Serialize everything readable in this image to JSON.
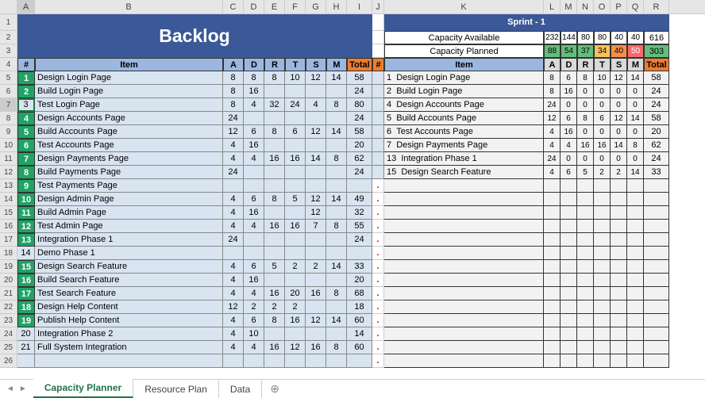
{
  "columns": [
    "",
    "A",
    "B",
    "C",
    "D",
    "E",
    "F",
    "G",
    "H",
    "I",
    "J",
    "K",
    "L",
    "M",
    "N",
    "O",
    "P",
    "Q",
    "R"
  ],
  "column_widths": [
    "22",
    "22",
    "237",
    "26",
    "26",
    "26",
    "26",
    "26",
    "26",
    "32",
    "15",
    "201",
    "21",
    "21",
    "21",
    "21",
    "21",
    "21",
    "32"
  ],
  "selected_cell": "A7",
  "selected_row": 7,
  "backlog_title": "Backlog",
  "sprint_title": "Sprint - 1",
  "capacity_available_label": "Capacity Available",
  "capacity_planned_label": "Capacity Planned",
  "capacity_available": {
    "A": "232",
    "D": "144",
    "R": "80",
    "T": "80",
    "S": "40",
    "M": "40",
    "Total": "616"
  },
  "capacity_planned": {
    "A": "88",
    "D": "54",
    "R": "37",
    "T": "34",
    "S": "40",
    "M": "50",
    "Total": "303"
  },
  "headers_left": {
    "num": "#",
    "item": "Item",
    "a": "A",
    "d": "D",
    "r": "R",
    "t": "T",
    "s": "S",
    "m": "M",
    "total": "Total"
  },
  "headers_right": {
    "num": "#",
    "item": "Item",
    "a": "A",
    "d": "D",
    "r": "R",
    "t": "T",
    "s": "S",
    "m": "M",
    "total": "Total"
  },
  "backlog": [
    {
      "n": "1",
      "item": "Design Login Page",
      "a": "8",
      "d": "8",
      "r": "8",
      "t": "10",
      "s": "12",
      "m": "14",
      "tot": "58",
      "green": true
    },
    {
      "n": "2",
      "item": "Build Login Page",
      "a": "8",
      "d": "16",
      "r": "",
      "t": "",
      "s": "",
      "m": "",
      "tot": "24",
      "green": true
    },
    {
      "n": "3",
      "item": "Test Login Page",
      "a": "8",
      "d": "4",
      "r": "32",
      "t": "24",
      "s": "4",
      "m": "8",
      "tot": "80",
      "green": false
    },
    {
      "n": "4",
      "item": "Design Accounts Page",
      "a": "24",
      "d": "",
      "r": "",
      "t": "",
      "s": "",
      "m": "",
      "tot": "24",
      "green": true
    },
    {
      "n": "5",
      "item": "Build Accounts Page",
      "a": "12",
      "d": "6",
      "r": "8",
      "t": "6",
      "s": "12",
      "m": "14",
      "tot": "58",
      "green": true
    },
    {
      "n": "6",
      "item": "Test Accounts Page",
      "a": "4",
      "d": "16",
      "r": "",
      "t": "",
      "s": "",
      "m": "",
      "tot": "20",
      "green": true
    },
    {
      "n": "7",
      "item": "Design Payments Page",
      "a": "4",
      "d": "4",
      "r": "16",
      "t": "16",
      "s": "14",
      "m": "8",
      "tot": "62",
      "green": true
    },
    {
      "n": "8",
      "item": "Build Payments Page",
      "a": "24",
      "d": "",
      "r": "",
      "t": "",
      "s": "",
      "m": "",
      "tot": "24",
      "green": true
    },
    {
      "n": "9",
      "item": "Test Payments Page",
      "a": "",
      "d": "",
      "r": "",
      "t": "",
      "s": "",
      "m": "",
      "tot": "",
      "green": true
    },
    {
      "n": "10",
      "item": "Design Admin Page",
      "a": "4",
      "d": "6",
      "r": "8",
      "t": "5",
      "s": "12",
      "m": "14",
      "tot": "49",
      "green": true
    },
    {
      "n": "11",
      "item": "Build Admin Page",
      "a": "4",
      "d": "16",
      "r": "",
      "t": "",
      "s": "12",
      "m": "",
      "tot": "32",
      "green": true
    },
    {
      "n": "12",
      "item": "Test Admin Page",
      "a": "4",
      "d": "4",
      "r": "16",
      "t": "16",
      "s": "7",
      "m": "8",
      "tot": "55",
      "green": true
    },
    {
      "n": "13",
      "item": "Integration Phase 1",
      "a": "24",
      "d": "",
      "r": "",
      "t": "",
      "s": "",
      "m": "",
      "tot": "24",
      "green": true
    },
    {
      "n": "14",
      "item": "Demo Phase 1",
      "a": "",
      "d": "",
      "r": "",
      "t": "",
      "s": "",
      "m": "",
      "tot": "",
      "green": false
    },
    {
      "n": "15",
      "item": "Design Search Feature",
      "a": "4",
      "d": "6",
      "r": "5",
      "t": "2",
      "s": "2",
      "m": "14",
      "tot": "33",
      "green": true
    },
    {
      "n": "16",
      "item": "Build Search Feature",
      "a": "4",
      "d": "16",
      "r": "",
      "t": "",
      "s": "",
      "m": "",
      "tot": "20",
      "green": true
    },
    {
      "n": "17",
      "item": "Test Search Feature",
      "a": "4",
      "d": "4",
      "r": "16",
      "t": "20",
      "s": "16",
      "m": "8",
      "tot": "68",
      "green": true
    },
    {
      "n": "18",
      "item": "Design Help Content",
      "a": "12",
      "d": "2",
      "r": "2",
      "t": "2",
      "s": "",
      "m": "",
      "tot": "18",
      "green": true
    },
    {
      "n": "19",
      "item": "Publish Help Content",
      "a": "4",
      "d": "6",
      "r": "8",
      "t": "16",
      "s": "12",
      "m": "14",
      "tot": "60",
      "green": true
    },
    {
      "n": "20",
      "item": "Integration Phase 2",
      "a": "4",
      "d": "10",
      "r": "",
      "t": "",
      "s": "",
      "m": "",
      "tot": "14",
      "green": false
    },
    {
      "n": "21",
      "item": "Full System Integration",
      "a": "4",
      "d": "4",
      "r": "16",
      "t": "12",
      "s": "16",
      "m": "8",
      "tot": "60",
      "green": false
    }
  ],
  "sprint": [
    {
      "n": "1",
      "item": "Design Login Page",
      "a": "8",
      "d": "6",
      "r": "8",
      "t": "10",
      "s": "12",
      "m": "14",
      "tot": "58"
    },
    {
      "n": "2",
      "item": "Build Login Page",
      "a": "8",
      "d": "16",
      "r": "0",
      "t": "0",
      "s": "0",
      "m": "0",
      "tot": "24"
    },
    {
      "n": "4",
      "item": "Design Accounts Page",
      "a": "24",
      "d": "0",
      "r": "0",
      "t": "0",
      "s": "0",
      "m": "0",
      "tot": "24"
    },
    {
      "n": "5",
      "item": "Build Accounts Page",
      "a": "12",
      "d": "6",
      "r": "8",
      "t": "6",
      "s": "12",
      "m": "14",
      "tot": "58"
    },
    {
      "n": "6",
      "item": "Test Accounts Page",
      "a": "4",
      "d": "16",
      "r": "0",
      "t": "0",
      "s": "0",
      "m": "0",
      "tot": "20"
    },
    {
      "n": "7",
      "item": "Design Payments Page",
      "a": "4",
      "d": "4",
      "r": "16",
      "t": "16",
      "s": "14",
      "m": "8",
      "tot": "62"
    },
    {
      "n": "13",
      "item": "Integration Phase 1",
      "a": "24",
      "d": "0",
      "r": "0",
      "t": "0",
      "s": "0",
      "m": "0",
      "tot": "24"
    },
    {
      "n": "15",
      "item": "Design Search Feature",
      "a": "4",
      "d": "6",
      "r": "5",
      "t": "2",
      "s": "2",
      "m": "14",
      "tot": "33"
    }
  ],
  "planned_colors": {
    "A": "cap-g",
    "D": "cap-g",
    "R": "cap-g",
    "T": "cap-y",
    "S": "cap-o",
    "M": "cap-r",
    "Total": "cap-g"
  },
  "tabs": [
    {
      "label": "Capacity Planner",
      "active": true
    },
    {
      "label": "Resource Plan",
      "active": false
    },
    {
      "label": "Data",
      "active": false
    }
  ],
  "add_tab": "⊕",
  "dot": "."
}
